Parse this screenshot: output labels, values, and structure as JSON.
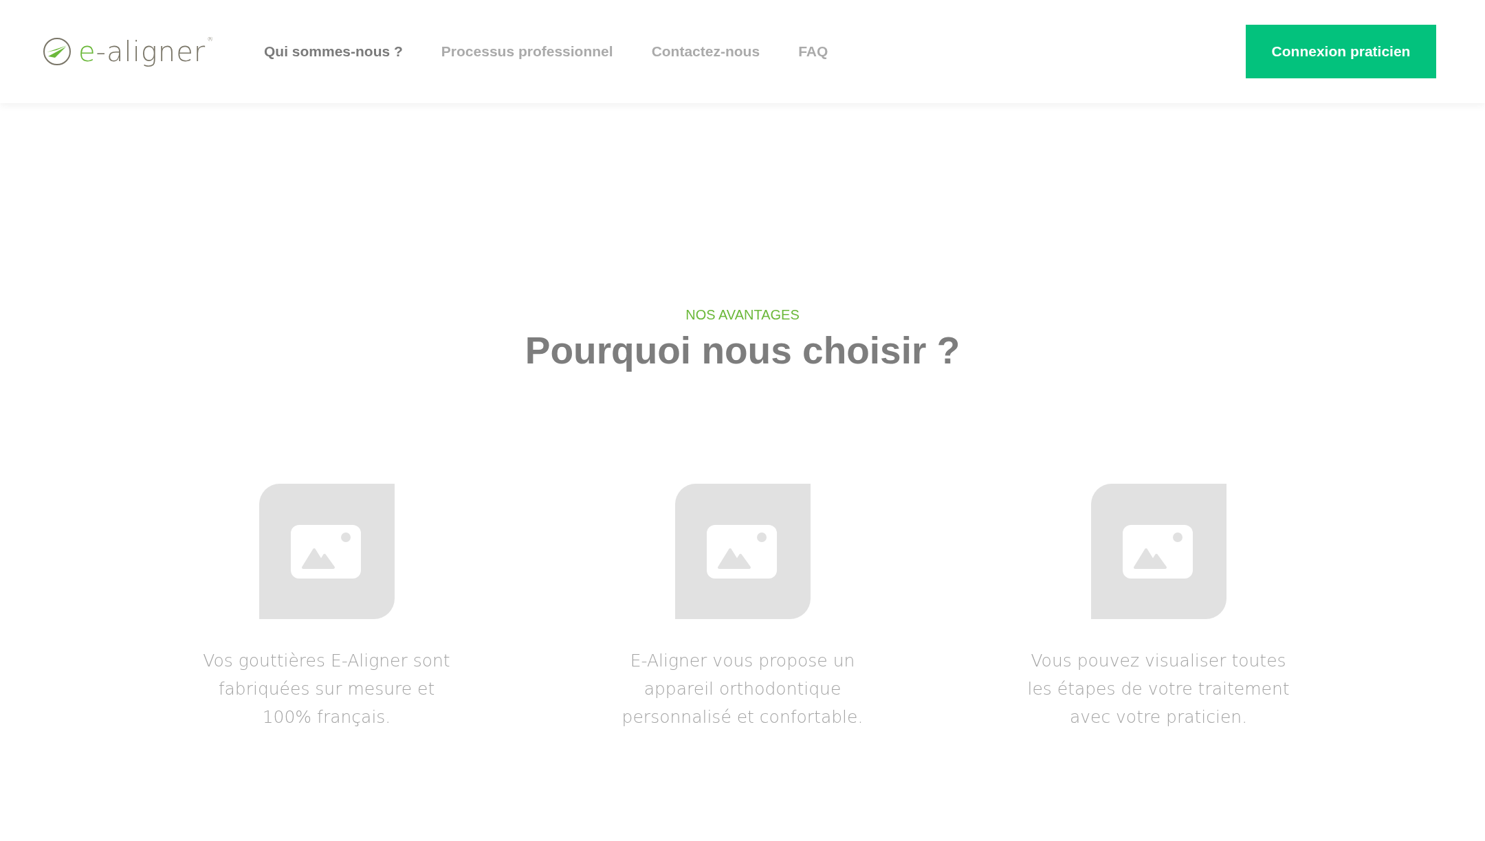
{
  "header": {
    "logo": {
      "text": "e-aligner",
      "mark": "®"
    },
    "nav": [
      {
        "label": "Qui sommes-nous ?",
        "selected": true
      },
      {
        "label": "Processus professionnel",
        "selected": false
      },
      {
        "label": "Contactez-nous",
        "selected": false
      },
      {
        "label": "FAQ",
        "selected": false
      }
    ],
    "cta": "Connexion praticien"
  },
  "section": {
    "kicker": "NOS AVANTAGES",
    "title": "Pourquoi nous choisir ?",
    "features": [
      {
        "lines": [
          "Vos gouttières E-Aligner sont",
          "fabriquées sur mesure et",
          "100% français."
        ]
      },
      {
        "lines": [
          "E-Aligner vous propose un",
          "appareil orthodontique",
          "personnalisé et confortable."
        ]
      },
      {
        "lines": [
          "Vous pouvez visualiser toutes",
          "les étapes de votre traitement",
          "avec votre praticien."
        ]
      }
    ]
  }
}
